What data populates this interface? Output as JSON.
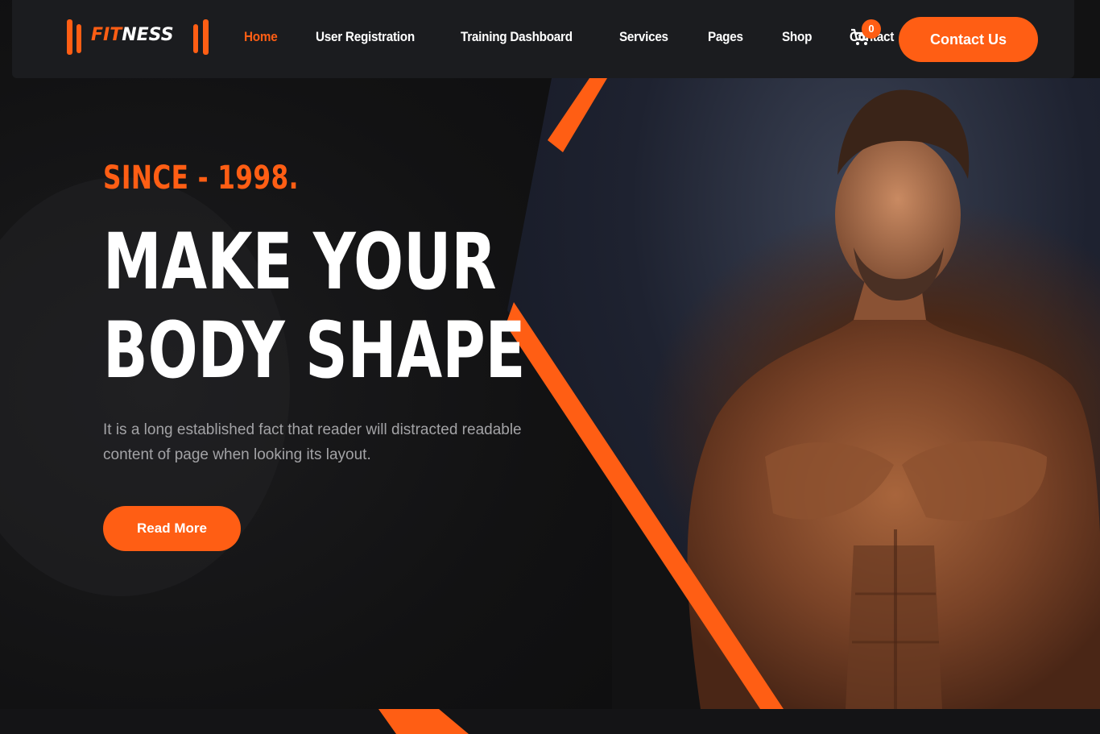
{
  "brand": {
    "logo_prefix": "FIT",
    "logo_suffix": "NESS",
    "accent": "#ff5e14",
    "background": "#121213"
  },
  "nav": {
    "items": [
      {
        "label": "Home",
        "active": true
      },
      {
        "label": "User Registration",
        "active": false
      },
      {
        "label": "Training Dashboard",
        "active": false
      },
      {
        "label": "Services",
        "active": false
      },
      {
        "label": "Pages",
        "active": false
      },
      {
        "label": "Shop",
        "active": false
      },
      {
        "label": "Contact",
        "active": false
      }
    ],
    "cart_icon": "shopping-cart-icon",
    "cart_count": "0",
    "cta_label": "Contact Us"
  },
  "hero": {
    "eyebrow": "SINCE - 1998.",
    "headline_line1": "MAKE YOUR",
    "headline_line2": "BODY SHAPE",
    "lead": "It is a long established fact that reader will distracted readable content of page when looking its layout.",
    "button_label": "Read More"
  }
}
